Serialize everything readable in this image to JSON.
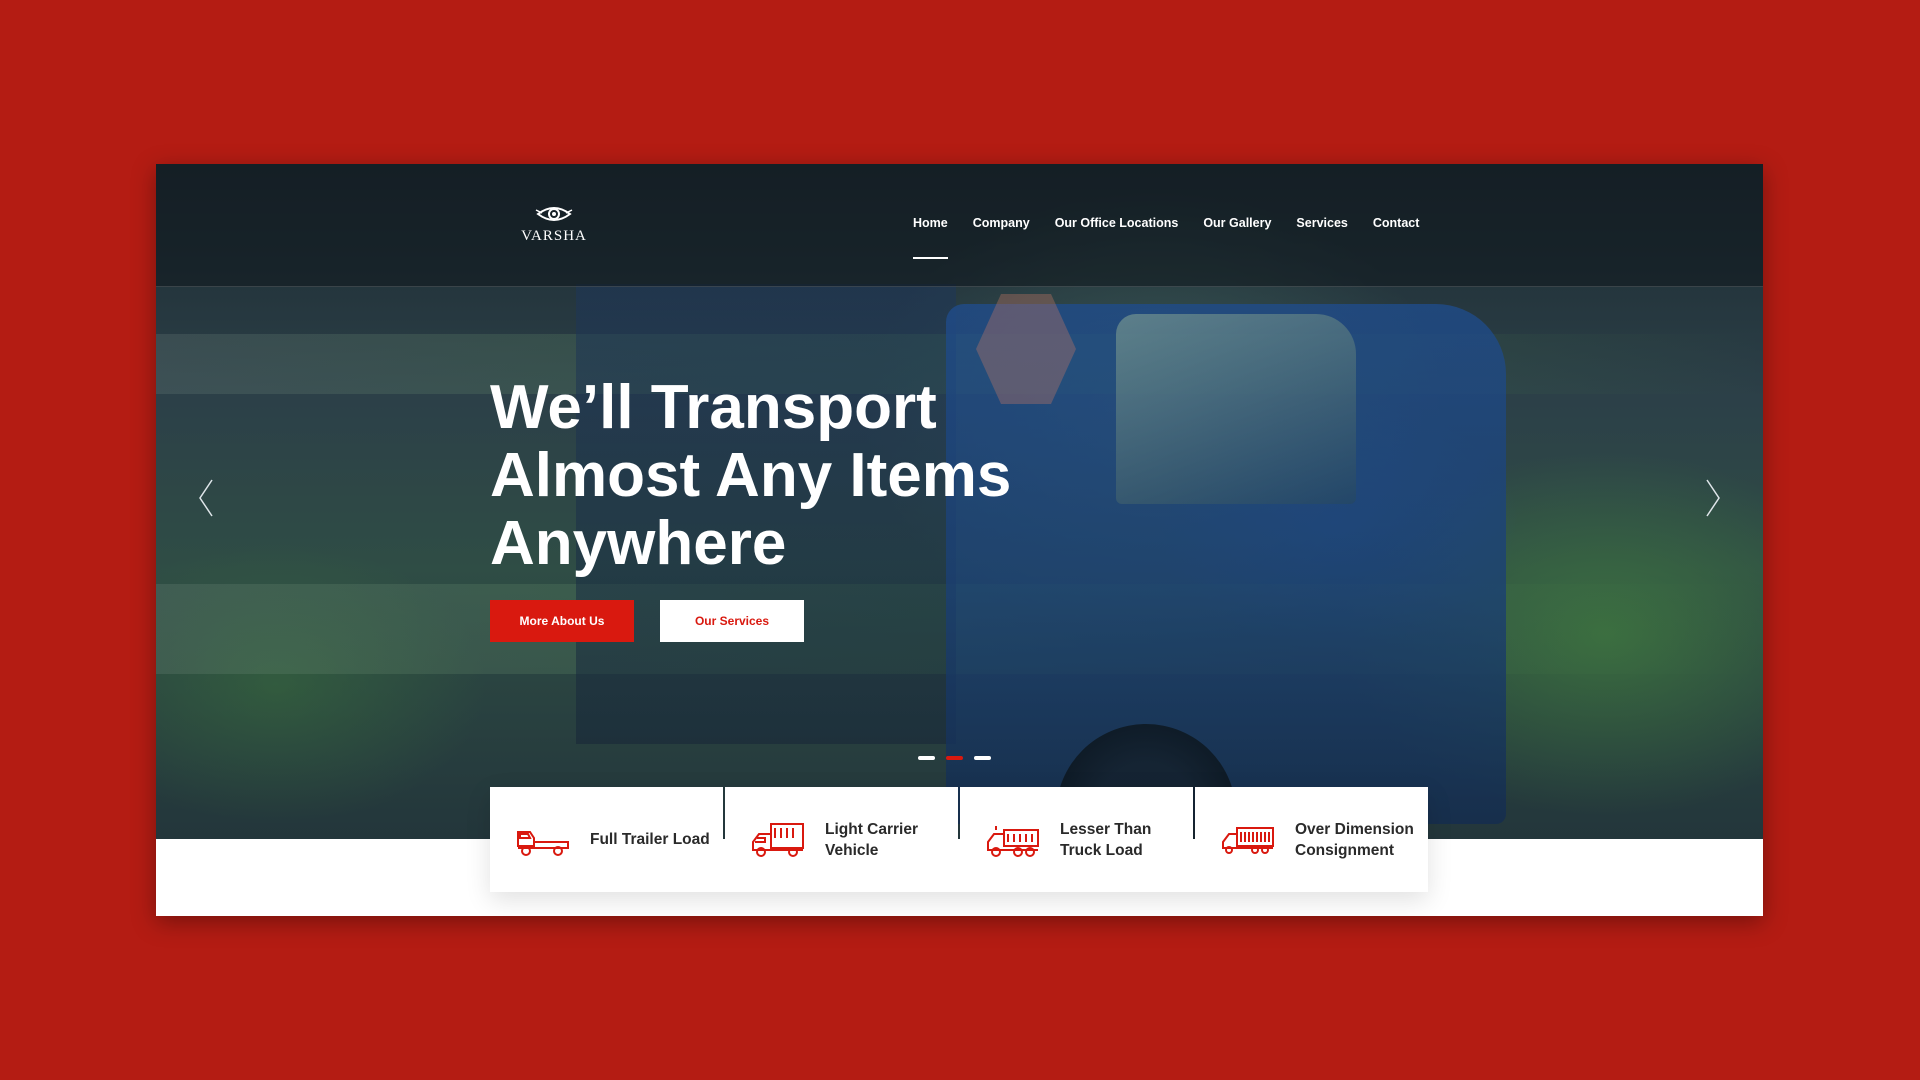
{
  "brand": {
    "name": "VARSHA"
  },
  "nav": {
    "items": [
      {
        "label": "Home",
        "active": true
      },
      {
        "label": "Company"
      },
      {
        "label": "Our Office Locations"
      },
      {
        "label": "Our Gallery"
      },
      {
        "label": "Services"
      },
      {
        "label": "Contact"
      }
    ]
  },
  "hero": {
    "title_lines": [
      "We’ll Transport",
      "Almost Any Items",
      "Anywhere"
    ],
    "primary_button": "More About Us",
    "secondary_button": "Our Services",
    "slides": {
      "count": 3,
      "active_index": 1
    }
  },
  "services": [
    {
      "label": "Full Trailer Load",
      "icon": "flatbed-truck-icon"
    },
    {
      "label": "Light Carrier Vehicle",
      "icon": "box-truck-icon"
    },
    {
      "label": "Lesser Than Truck Load",
      "icon": "dump-truck-icon"
    },
    {
      "label": "Over Dimension Consignment",
      "icon": "cargo-trailer-icon"
    }
  ],
  "colors": {
    "background": "#b41c13",
    "accent": "#d9190f",
    "white": "#ffffff",
    "text_dark": "#2a2a2a"
  }
}
